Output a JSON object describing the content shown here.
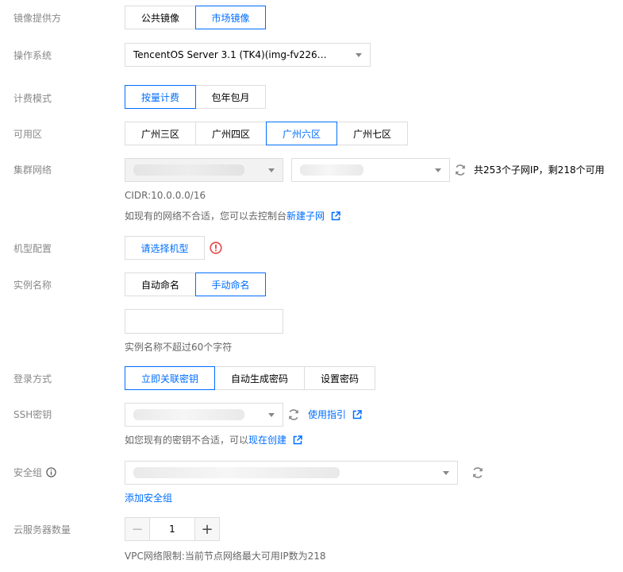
{
  "image_provider": {
    "label": "镜像提供方",
    "options": [
      "公共镜像",
      "市场镜像"
    ],
    "selected_index": 1
  },
  "os": {
    "label": "操作系统",
    "value": "TencentOS Server 3.1 (TK4)(img-fv226…"
  },
  "billing": {
    "label": "计费模式",
    "options": [
      "按量计费",
      "包年包月"
    ],
    "selected_index": 0
  },
  "zone": {
    "label": "可用区",
    "options": [
      "广州三区",
      "广州四区",
      "广州六区",
      "广州七区"
    ],
    "selected_index": 2
  },
  "cluster_network": {
    "label": "集群网络",
    "subnet_info": "共253个子网IP，剩218个可用",
    "cidr": "CIDR:10.0.0.0/16",
    "hint_text": "如现有的网络不合适，您可以去控制台",
    "hint_link": "新建子网"
  },
  "instance_type": {
    "label": "机型配置",
    "button": "请选择机型"
  },
  "instance_name": {
    "label": "实例名称",
    "options": [
      "自动命名",
      "手动命名"
    ],
    "selected_index": 1,
    "input_value": "",
    "hint": "实例名称不超过60个字符"
  },
  "login": {
    "label": "登录方式",
    "options": [
      "立即关联密钥",
      "自动生成密码",
      "设置密码"
    ],
    "selected_index": 0
  },
  "ssh_key": {
    "label": "SSH密钥",
    "guide_link": "使用指引",
    "hint_text": "如您现有的密钥不合适，可以",
    "hint_link": "现在创建"
  },
  "security_group": {
    "label": "安全组",
    "add_link": "添加安全组"
  },
  "server_count": {
    "label": "云服务器数量",
    "value": "1",
    "minus": "−",
    "plus": "+",
    "hint": "VPC网络限制:当前节点网络最大可用IP数为218"
  },
  "colors": {
    "accent": "#006eff",
    "error": "#e54545",
    "label": "#888888",
    "border": "#dddddd"
  }
}
